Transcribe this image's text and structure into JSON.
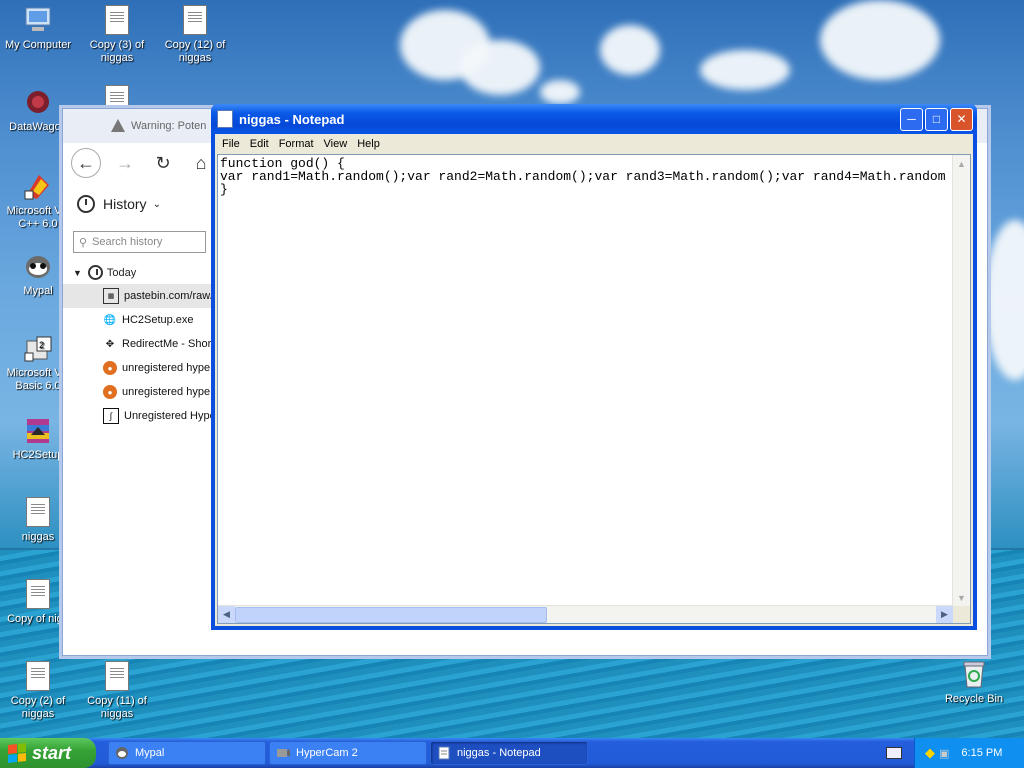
{
  "desktop": {
    "icons": [
      {
        "label": "My Computer",
        "icon": "computer-icon"
      },
      {
        "label": "Copy (3) of niggas",
        "icon": "text-file-icon"
      },
      {
        "label": "Copy (12) of niggas",
        "icon": "text-file-icon"
      },
      {
        "label": "DataWagon",
        "icon": "datawagon-icon"
      },
      {
        "label": "Microsoft Vis C++ 6.0",
        "icon": "visual-cpp-icon"
      },
      {
        "label": "Mypal",
        "icon": "mypal-icon"
      },
      {
        "label": "Microsoft Vis Basic 6.0",
        "icon": "visual-basic-icon"
      },
      {
        "label": "HC2Setup",
        "icon": "winrar-icon"
      },
      {
        "label": "niggas",
        "icon": "text-file-icon"
      },
      {
        "label": "Copy of nigg",
        "icon": "text-file-icon"
      },
      {
        "label": "Copy (2) of niggas",
        "icon": "text-file-icon"
      },
      {
        "label": "Copy (11) of niggas",
        "icon": "text-file-icon"
      },
      {
        "label": "Recycle Bin",
        "icon": "recycle-bin-icon"
      }
    ]
  },
  "history_window": {
    "title": "Warning: Poten",
    "heading": "History",
    "search_placeholder": "Search history",
    "group": "Today",
    "items": [
      {
        "label": "pastebin.com/raw/",
        "icon": "pastebin-icon"
      },
      {
        "label": "HC2Setup.exe",
        "icon": "globe-icon"
      },
      {
        "label": "RedirectMe - Short",
        "icon": "move-arrows-icon"
      },
      {
        "label": "unregistered hype",
        "icon": "hypercam-icon"
      },
      {
        "label": "unregistered hype",
        "icon": "hypercam-icon"
      },
      {
        "label": "Unregistered Hype",
        "icon": "museum-icon"
      }
    ]
  },
  "notepad": {
    "title": "niggas - Notepad",
    "menu": [
      "File",
      "Edit",
      "Format",
      "View",
      "Help"
    ],
    "content": "function god() {\nvar rand1=Math.random();var rand2=Math.random();var rand3=Math.random();var rand4=Math.random\n}"
  },
  "taskbar": {
    "start_label": "start",
    "buttons": [
      {
        "label": "Mypal",
        "icon": "mypal-icon"
      },
      {
        "label": "HyperCam 2",
        "icon": "hypercam-icon"
      },
      {
        "label": "niggas - Notepad",
        "icon": "notepad-icon"
      }
    ],
    "clock": "6:15 PM"
  },
  "colors": {
    "xp_blue": "#0b4fe0",
    "start_green": "#36a336",
    "tray_blue": "#0f8ff0"
  }
}
